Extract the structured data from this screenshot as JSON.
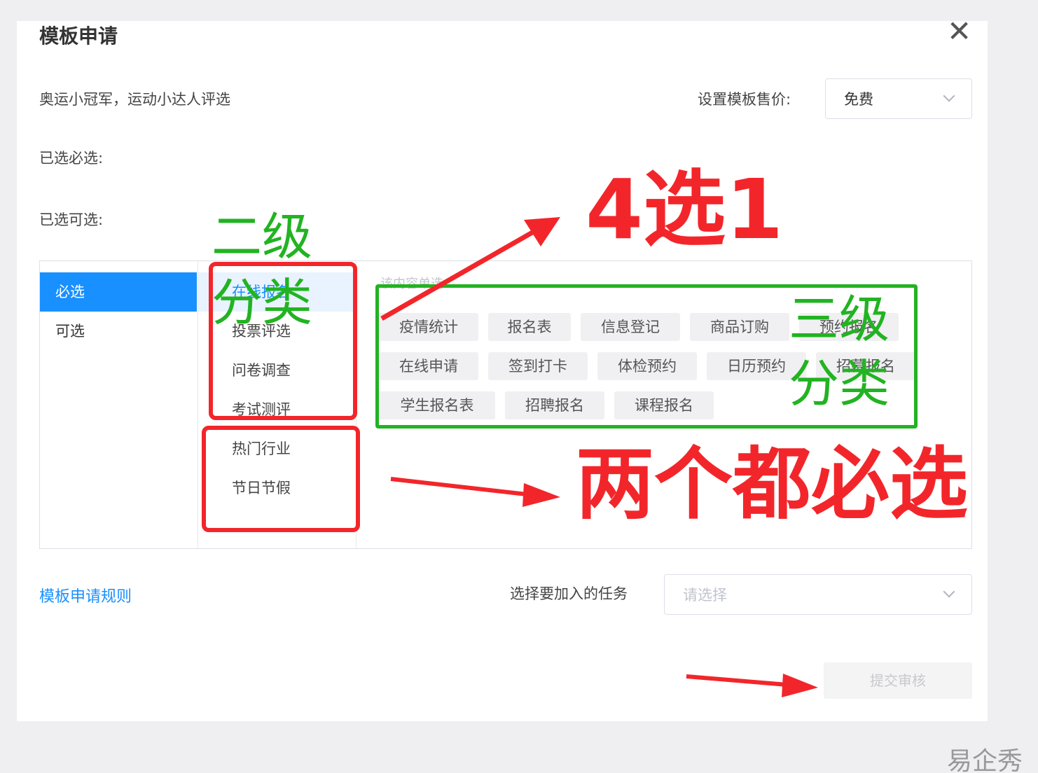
{
  "dialog": {
    "title": "模板申请",
    "template_name": "奥运小冠军，运动小达人评选",
    "price_label": "设置模板售价:",
    "price_value": "免费",
    "selected_required_label": "已选必选:",
    "selected_optional_label": "已选可选:"
  },
  "level1": [
    {
      "label": "必选",
      "active": true
    },
    {
      "label": "可选",
      "active": false
    }
  ],
  "level2": [
    {
      "label": "在线报名",
      "active": true
    },
    {
      "label": "投票评选",
      "active": false
    },
    {
      "label": "问卷调查",
      "active": false
    },
    {
      "label": "考试测评",
      "active": false
    },
    {
      "label": "热门行业",
      "active": false
    },
    {
      "label": "节日节假",
      "active": false
    }
  ],
  "level3_hint": "该内容单选",
  "level3": [
    [
      "疫情统计",
      "报名表",
      "信息登记",
      "商品订购",
      "预约报名"
    ],
    [
      "在线申请",
      "签到打卡",
      "体检预约",
      "日历预约",
      "招募报名"
    ],
    [
      "学生报名表",
      "招聘报名",
      "课程报名"
    ]
  ],
  "footer": {
    "rules_link": "模板申请规则",
    "task_label": "选择要加入的任务",
    "task_placeholder": "请选择",
    "submit_label": "提交审核"
  },
  "annotations": {
    "level2_label_a": "二级",
    "level2_label_b": "分类",
    "level3_label_a": "三级",
    "level3_label_b": "分类",
    "pick_one": "4选1",
    "both_required": "两个都必选"
  },
  "watermark": "易企秀",
  "colors": {
    "primary": "#1890ff",
    "annotation_red": "#f2262a",
    "annotation_green": "#22b322"
  },
  "icons": {
    "close": "close-icon",
    "dropdown": "chevron-down-icon"
  }
}
